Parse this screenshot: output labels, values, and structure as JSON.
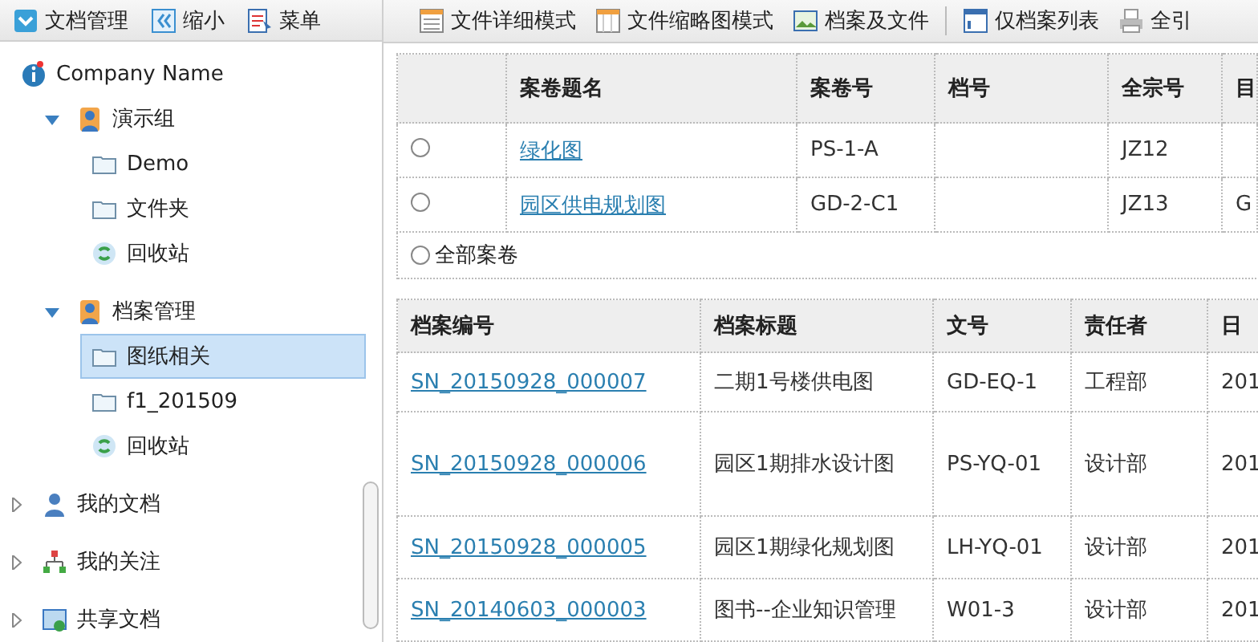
{
  "left_toolbar": [
    {
      "label": "文档管理",
      "kind": "dropdown"
    },
    {
      "label": "缩小",
      "kind": "collapse"
    },
    {
      "label": "菜单",
      "kind": "menu"
    }
  ],
  "tree": [
    {
      "label": "Company Name",
      "kind": "info",
      "selected": false,
      "children": [
        {
          "label": "演示组",
          "kind": "user",
          "expanded": true,
          "selected": false,
          "children": [
            {
              "label": "Demo",
              "kind": "folder",
              "selected": false
            },
            {
              "label": "文件夹",
              "kind": "folder",
              "selected": false
            },
            {
              "label": "回收站",
              "kind": "recycle",
              "selected": false
            }
          ]
        },
        {
          "label": "档案管理",
          "kind": "user",
          "expanded": true,
          "selected": false,
          "children": [
            {
              "label": "图纸相关",
              "kind": "folder",
              "selected": true
            },
            {
              "label": "f1_201509",
              "kind": "folder",
              "selected": false
            },
            {
              "label": "回收站",
              "kind": "recycle",
              "selected": false
            }
          ]
        }
      ]
    },
    {
      "label": "我的文档",
      "kind": "person",
      "expanded": false,
      "selected": false
    },
    {
      "label": "我的关注",
      "kind": "network",
      "expanded": false,
      "selected": false
    },
    {
      "label": "共享文档",
      "kind": "shared",
      "expanded": false,
      "selected": false
    }
  ],
  "toolbar": [
    {
      "label": "文件详细模式",
      "kind": "list"
    },
    {
      "label": "文件缩略图模式",
      "kind": "thumbs"
    },
    {
      "label": "档案及文件",
      "kind": "image"
    },
    {
      "label": "仅档案列表",
      "kind": "window"
    },
    {
      "label": "全引",
      "kind": "printer"
    }
  ],
  "volume_table": {
    "columns": [
      "案卷题名",
      "案卷号",
      "档号",
      "全宗号",
      "目"
    ],
    "rows": [
      {
        "selected": false,
        "cells": [
          "绿化图",
          "PS-1-A",
          "",
          "JZ12",
          ""
        ]
      },
      {
        "selected": false,
        "cells": [
          "园区供电规划图",
          "GD-2-C1",
          "",
          "JZ13",
          "G"
        ]
      }
    ],
    "all_option": {
      "label": "全部案卷",
      "selected": false
    }
  },
  "file_table": {
    "columns": [
      "档案编号",
      "档案标题",
      "文号",
      "责任者",
      "日"
    ],
    "rows": [
      [
        "SN_20150928_000007",
        "二期1号楼供电图",
        "GD-EQ-1",
        "工程部",
        "201"
      ],
      [
        "SN_20150928_000006",
        "园区1期排水设计图",
        "PS-YQ-01",
        "设计部",
        "201"
      ],
      [
        "SN_20150928_000005",
        "园区1期绿化规划图",
        "LH-YQ-01",
        "设计部",
        "201"
      ],
      [
        "SN_20140603_000003",
        "图书--企业知识管理",
        "W01-3",
        "设计部",
        "201"
      ]
    ]
  }
}
